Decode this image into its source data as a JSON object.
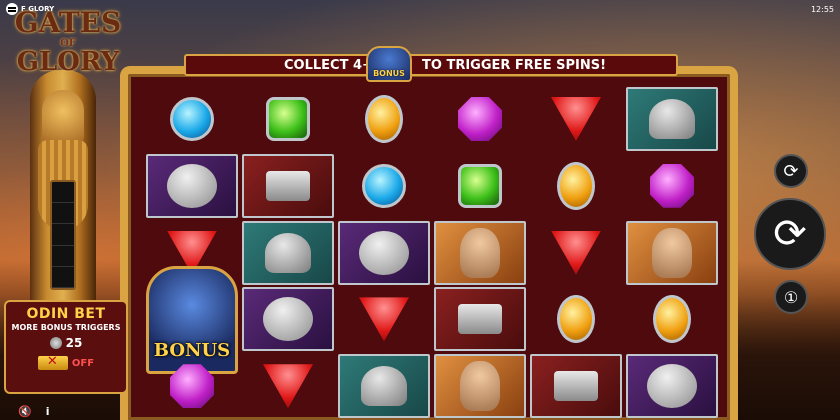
{
  "topbar": {
    "brand": "F GLORY",
    "clock": "12:55"
  },
  "logo": {
    "line1": "GATES",
    "line2": "OF",
    "line3": "GLORY"
  },
  "banner": {
    "left_text": "COLLECT 4+",
    "bonus_label": "BONUS",
    "right_text": "TO TRIGGER FREE SPINS!"
  },
  "odin_bet": {
    "title": "ODIN BET",
    "subtitle": "MORE BONUS TRIGGERS",
    "cost": "25",
    "state": "OFF"
  },
  "bottom_left": {
    "sound_icon": "speaker-mute-icon",
    "info_icon": "info-icon"
  },
  "controls": {
    "autoplay_icon": "autoplay-icon",
    "spin_icon": "spin-icon",
    "turbo_icon": "turbo-icon"
  },
  "grid": {
    "columns": 6,
    "rows": 5,
    "bonus_symbol_label": "BONUS",
    "cells": [
      [
        "blue",
        "green",
        "orange",
        "purple",
        "red",
        "helmet"
      ],
      [
        "axe",
        "hammer",
        "blue",
        "green",
        "orange",
        "purple"
      ],
      [
        "red",
        "helmet",
        "axe",
        "viking",
        "red",
        "viking"
      ],
      [
        "bonus",
        "axe",
        "red",
        "hammer",
        "orange",
        "orange"
      ],
      [
        "purple",
        "red",
        "helmet",
        "viking",
        "hammer",
        "axe"
      ]
    ]
  }
}
